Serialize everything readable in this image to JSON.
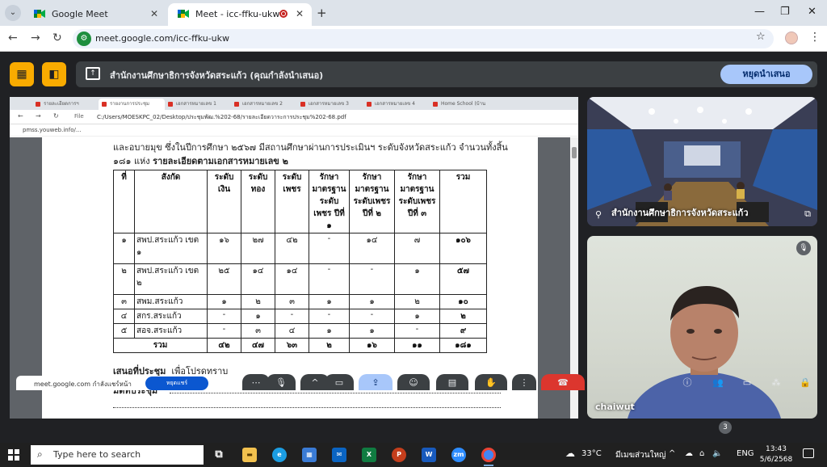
{
  "browser": {
    "tabs": [
      {
        "title": "Google Meet",
        "active": false
      },
      {
        "title": "Meet - icc-ffku-ukw",
        "active": true
      }
    ],
    "url": "meet.google.com/icc-ffku-ukw",
    "icons": [
      "menu-icon",
      "back-icon",
      "forward-icon",
      "reload-icon",
      "star-icon",
      "profile-avatar",
      "kebab-icon"
    ]
  },
  "meet": {
    "presenter_text": "สำนักงานศึกษาธิการจังหวัดสระแก้ว (คุณกำลังนำเสนอ)",
    "stop_label": "หยุดนำเสนอ",
    "tile1_name": "สำนักงานศึกษาธิการจังหวัดสระแก้ว",
    "tile2_name": "chaiwut",
    "participants_badge": "3",
    "notification_text": "meet.google.com กำลังแชร์หน้า",
    "notification_button": "หยุดแชร์",
    "accent": "#a8c7fa"
  },
  "shared": {
    "tab_labels": [
      "รายละเอียดการฯ",
      "รายงานการประชุม",
      "เอกสารหมายเลข 1",
      "เอกสารหมายเลข 2",
      "เอกสารหมายเลข 3",
      "เอกสารหมายเลข 4",
      "Home School (บ้าน"
    ],
    "file_label": "File",
    "path": "C:/Users/MOESKPC_02/Desktop/ประชุมพัฒ.%202-68/รายละเอียดวาระการประชุม%202-68.pdf",
    "bookmark": "pmss.youweb.info/...",
    "intro_line1": "และอบายมุข ซึ่งในปีการศึกษา ๒๕๖๗ มีสถานศึกษาผ่านการประเมินฯ ระดับจังหวัดสระแก้ว จำนวนทั้งสิ้น",
    "intro_line2_plain": "๑๘๑ แห่ง ",
    "intro_line2_bold": "รายละเอียดตามเอกสารหมายเลข ๒",
    "table": {
      "headers": [
        "ที่",
        "สังกัด",
        "ระดับเงิน",
        "ระดับทอง",
        "ระดับเพชร",
        "รักษามาตรฐานระดับเพชร ปีที่ ๑",
        "รักษามาตรฐานระดับเพชร ปีที่ ๒",
        "รักษามาตรฐานระดับเพชร ปีที่ ๓",
        "รวม"
      ],
      "rows": [
        [
          "๑",
          "สพป.สระแก้ว เขต ๑",
          "๑๖",
          "๒๗",
          "๔๒",
          "-",
          "๑๔",
          "๗",
          "๑๐๖"
        ],
        [
          "๒",
          "สพป.สระแก้ว เขต ๒",
          "๒๕",
          "๑๔",
          "๑๔",
          "-",
          "-",
          "๑",
          "๕๗"
        ],
        [
          "๓",
          "สพม.สระแก้ว",
          "๑",
          "๒",
          "๓",
          "๑",
          "๑",
          "๒",
          "๑๐"
        ],
        [
          "๔",
          "สกร.สระแก้ว",
          "-",
          "๑",
          "-",
          "-",
          "-",
          "๑",
          "๒"
        ],
        [
          "๕",
          "สอจ.สระแก้ว",
          "-",
          "๓",
          "๔",
          "๑",
          "๑",
          "-",
          "๙"
        ]
      ],
      "total": [
        "รวม",
        "๔๒",
        "๔๗",
        "๖๓",
        "๒",
        "๑๖",
        "๑๑",
        "๑๘๑"
      ]
    },
    "proposal_label": "เสนอที่ประชุม",
    "proposal_text": "เพื่อโปรดทราบ",
    "resolution_label": "มติที่ประชุม"
  },
  "taskbar": {
    "search_placeholder": "Type here to search",
    "apps": [
      "task-view",
      "file-explorer",
      "edge",
      "store",
      "mail",
      "excel",
      "powerpoint",
      "word",
      "zoom",
      "chrome"
    ],
    "weather": "33°C",
    "weather_text": "มีเมฆส่วนใหญ่",
    "lang": "ENG",
    "time": "13:43",
    "date": "5/6/2568"
  }
}
